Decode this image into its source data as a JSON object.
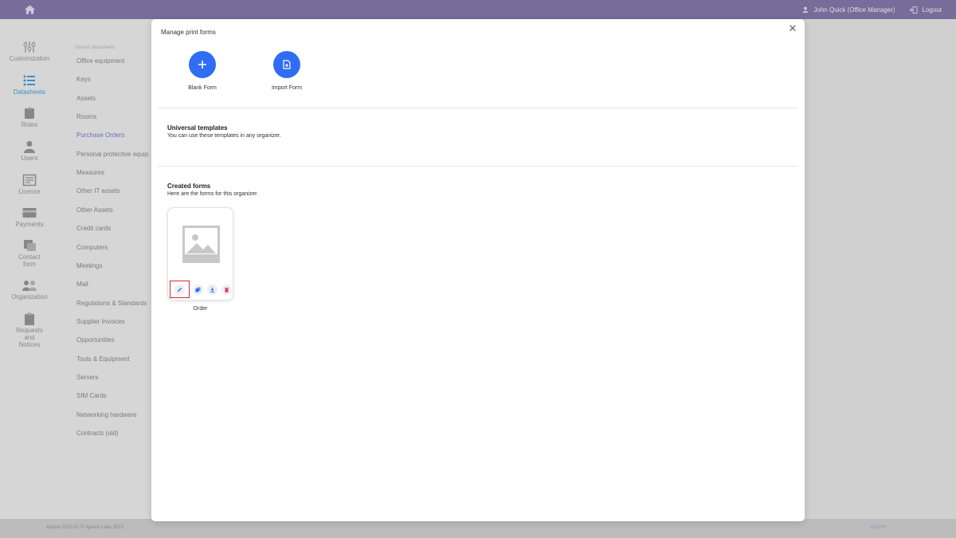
{
  "topbar": {
    "user_label": "John Quick  (Office Manager)",
    "logout_label": "Logout",
    "color": "#887bb0"
  },
  "leftnav": [
    {
      "label": "Customization",
      "icon": "sliders-icon"
    },
    {
      "label": "Datasheets",
      "icon": "list-icon",
      "active": true
    },
    {
      "label": "Roles",
      "icon": "badge-icon"
    },
    {
      "label": "Users",
      "icon": "user-icon"
    },
    {
      "label": "License",
      "icon": "license-icon"
    },
    {
      "label": "Payments",
      "icon": "card-icon"
    },
    {
      "label": "Contact form",
      "icon": "contact-icon"
    },
    {
      "label": "Organization",
      "icon": "organization-icon"
    },
    {
      "label": "Requests and Notices",
      "icon": "clipboard-icon"
    }
  ],
  "datasheets": {
    "search_placeholder": "Search datasheets",
    "items": [
      "Office equipment",
      "Keys",
      "Assets",
      "Rooms",
      "Purchase Orders",
      "Personal protective equip",
      "Measures",
      "Other IT assets",
      "Other Assets",
      "Credit cards",
      "Computers",
      "Meetings",
      "Mail",
      "Regulations & Standards",
      "Supplier Invoices",
      "Opportunities",
      "Tools & Equipment",
      "Servers",
      "SIM Cards",
      "Networking hardware",
      "Contracts (old)"
    ],
    "active_index": 4
  },
  "modal": {
    "title": "Manage print forms",
    "actions": {
      "blank_form": "Blank Form",
      "import_form": "Import Form"
    },
    "universal": {
      "title": "Universal templates",
      "subtitle": "You can use these templates in any organizer."
    },
    "created": {
      "title": "Created forms",
      "subtitle": "Here are the forms for this organizer.",
      "forms": [
        {
          "name": "Order"
        }
      ]
    },
    "accent_color": "#2f6df5",
    "highlight_color": "#d02c2c"
  },
  "footer": {
    "copyright": "Apliem 2110-01 © Apliem Labs 2021",
    "brand": "apliem"
  }
}
